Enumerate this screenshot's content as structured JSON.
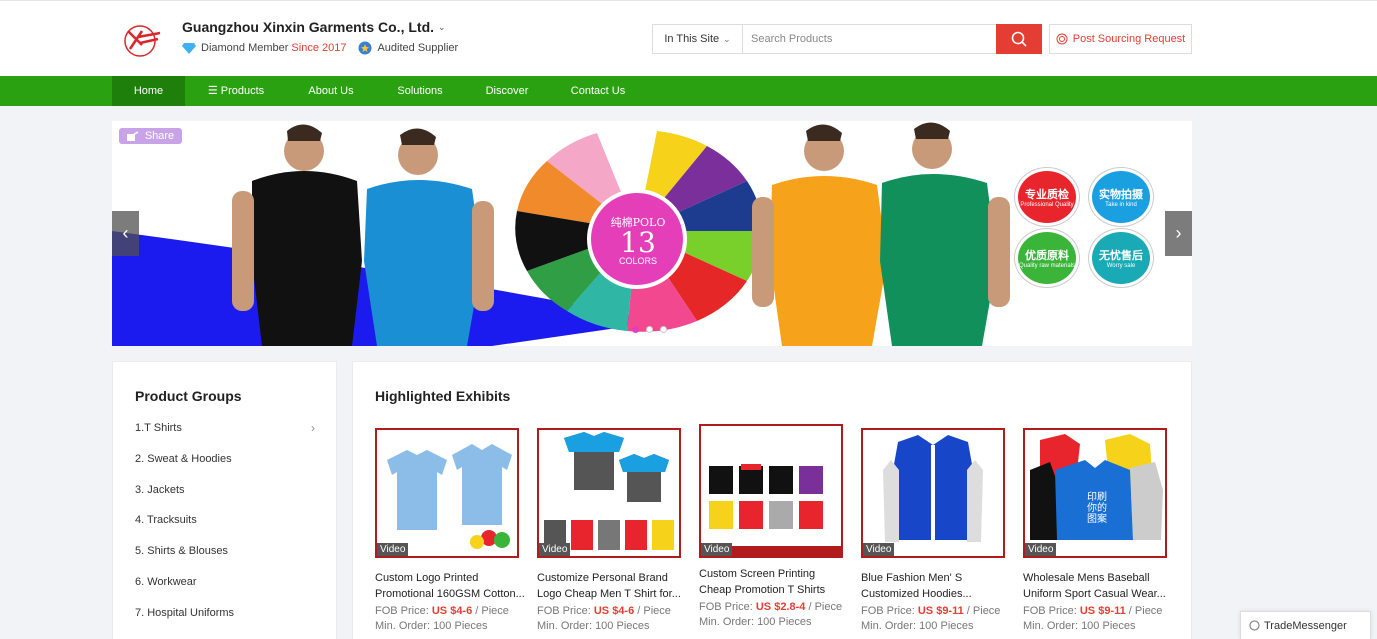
{
  "header": {
    "company_name": "Guangzhou Xinxin Garments Co., Ltd.",
    "member_label": "Diamond Member",
    "since_label": "Since 2017",
    "audited_label": "Audited Supplier"
  },
  "search": {
    "scope": "In This Site",
    "placeholder": "Search Products"
  },
  "post_sourcing": "Post Sourcing Request",
  "nav": {
    "home": "Home",
    "products": "Products",
    "about": "About Us",
    "solutions": "Solutions",
    "discover": "Discover",
    "contact": "Contact Us"
  },
  "banner": {
    "share": "Share",
    "polo_text": "纯棉POLO",
    "polo_number": "13",
    "polo_colors": "COLORS",
    "badges": [
      {
        "cn": "专业质检",
        "en": "Professional Quality",
        "color": "#e8242c"
      },
      {
        "cn": "实物拍摄",
        "en": "Take in kind",
        "color": "#1aa0e0"
      },
      {
        "cn": "优质原料",
        "en": "Quality raw materials",
        "color": "#3ab53a"
      },
      {
        "cn": "无忧售后",
        "en": "Worry sale",
        "color": "#19aab5"
      }
    ]
  },
  "groups": {
    "title": "Product Groups",
    "items": [
      "1.T Shirts",
      "2. Sweat & Hoodies",
      "3. Jackets",
      "4. Tracksuits",
      "5. Shirts & Blouses",
      "6. Workwear",
      "7. Hospital Uniforms"
    ]
  },
  "highlighted": {
    "title": "Highlighted Exhibits",
    "video_label": "Video",
    "fob_label": "FOB Price:",
    "unit": "/ Piece",
    "products": [
      {
        "name": "Custom Logo Printed Promotional 160GSM Cotton...",
        "price": "US $4-6",
        "moq": "Min. Order: 100 Pieces"
      },
      {
        "name": "Customize Personal Brand Logo Cheap Men T Shirt for...",
        "price": "US $4-6",
        "moq": "Min. Order: 100 Pieces"
      },
      {
        "name": "Custom Screen Printing Cheap Promotion T Shirts for...",
        "price": "US $2.8-4",
        "moq": "Min. Order: 100 Pieces"
      },
      {
        "name": "Blue Fashion Men' S Customized Hoodies...",
        "price": "US $9-11",
        "moq": "Min. Order: 100 Pieces"
      },
      {
        "name": "Wholesale Mens Baseball Uniform Sport Casual Wear...",
        "price": "US $9-11",
        "moq": "Min. Order: 100 Pieces"
      }
    ]
  },
  "trademessenger": "TradeMessenger"
}
